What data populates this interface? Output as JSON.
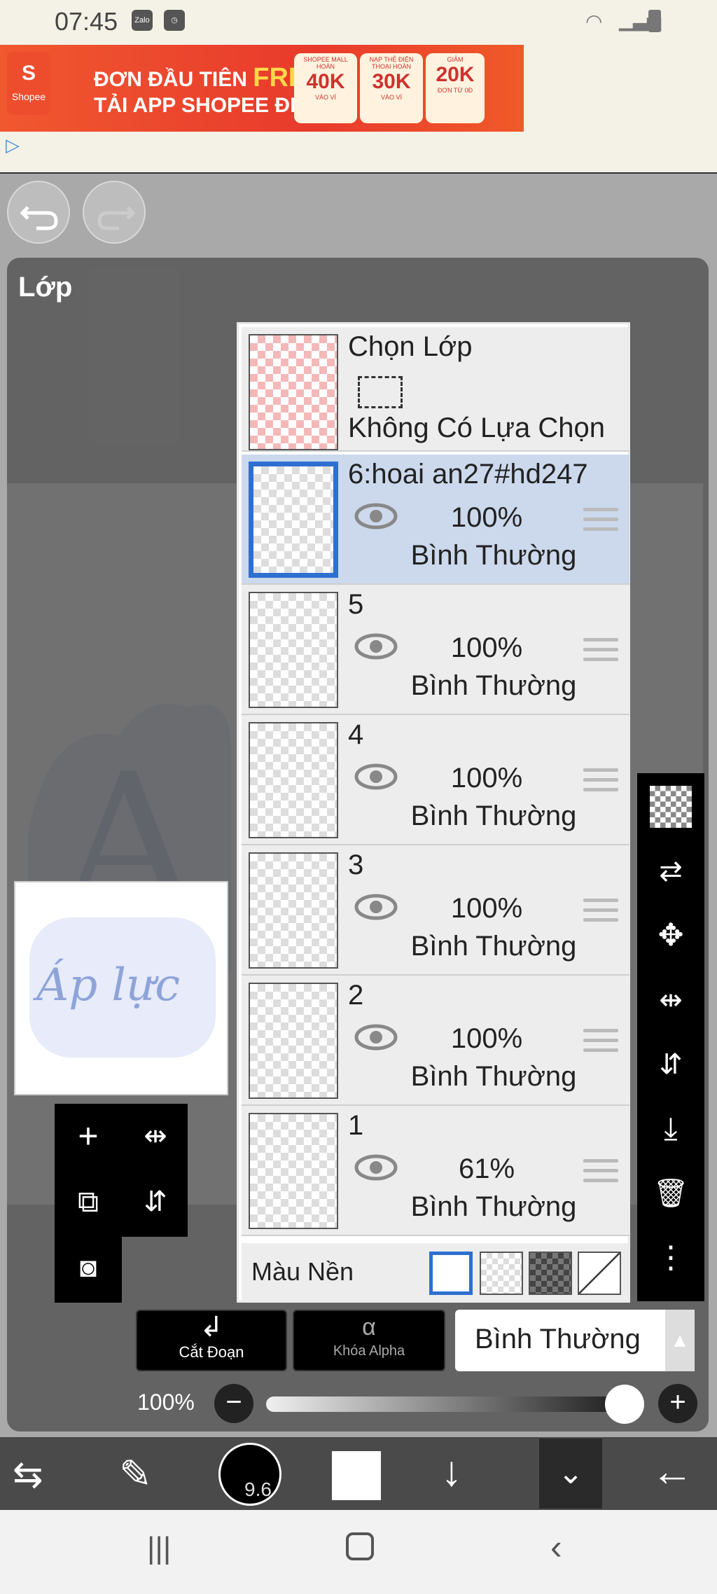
{
  "status_bar": {
    "time": "07:45",
    "zalo_label": "Zalo"
  },
  "ad": {
    "brand": "Shopee",
    "line1": "ĐƠN ĐẦU TIÊN",
    "free": "FREE",
    "line2": "TẢI APP SHOPEE ĐI",
    "coupons": [
      {
        "top": "SHOPEE MALL HOÀN",
        "value": "40K",
        "bottom": "VÀO VÍ"
      },
      {
        "top": "NẠP THẺ ĐIỆN THOẠI HOÀN",
        "value": "30K",
        "bottom": "VÀO VÍ"
      },
      {
        "top": "GIẢM",
        "value": "20K",
        "bottom": "ĐƠN TỪ 0Đ"
      }
    ]
  },
  "panel": {
    "title": "Lớp"
  },
  "selection_row": {
    "title": "Chọn Lớp",
    "subtitle": "Không Có Lựa Chọn"
  },
  "layers": [
    {
      "name": "6:hoai an27#hd247",
      "opacity": "100%",
      "mode": "Bình Thường",
      "selected": true
    },
    {
      "name": "5",
      "opacity": "100%",
      "mode": "Bình Thường",
      "selected": false
    },
    {
      "name": "4",
      "opacity": "100%",
      "mode": "Bình Thường",
      "selected": false
    },
    {
      "name": "3",
      "opacity": "100%",
      "mode": "Bình Thường",
      "selected": false
    },
    {
      "name": "2",
      "opacity": "100%",
      "mode": "Bình Thường",
      "selected": false
    },
    {
      "name": "1",
      "opacity": "61%",
      "mode": "Bình Thường",
      "selected": false
    }
  ],
  "background": {
    "label": "Màu Nền"
  },
  "preview": {
    "text": "Áp lực"
  },
  "bottom_controls": {
    "clip": "Cắt Đoạn",
    "alpha_lock": "Khóa Alpha",
    "blend_mode": "Bình Thường",
    "opacity": "100%",
    "opacity_value": 1.0
  },
  "toolbar": {
    "brush_size": "9.6"
  },
  "colors": {
    "accent": "#2f6fd0",
    "selected_row": "#ccd8ec"
  }
}
